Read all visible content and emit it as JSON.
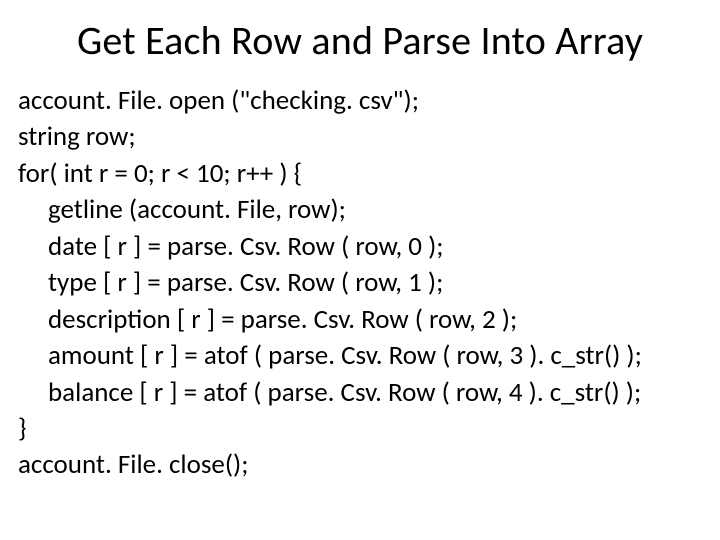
{
  "title": "Get Each Row and Parse Into Array",
  "code": {
    "l1": "account. File. open (\"checking. csv\");",
    "l2": "string row;",
    "l3": "for( int r = 0; r < 10; r++ ) {",
    "l4": "getline (account. File, row);",
    "l5": "date [ r ] = parse. Csv. Row ( row, 0 );",
    "l6": "type [ r ] = parse. Csv. Row ( row, 1 );",
    "l7": "description [ r ] = parse. Csv. Row ( row, 2 );",
    "l8": "amount [ r ] = atof ( parse. Csv. Row ( row, 3 ). c_str() );",
    "l9": "balance [ r ] = atof ( parse. Csv. Row ( row, 4 ). c_str() );",
    "l10": "}",
    "l11": "account. File. close();"
  }
}
